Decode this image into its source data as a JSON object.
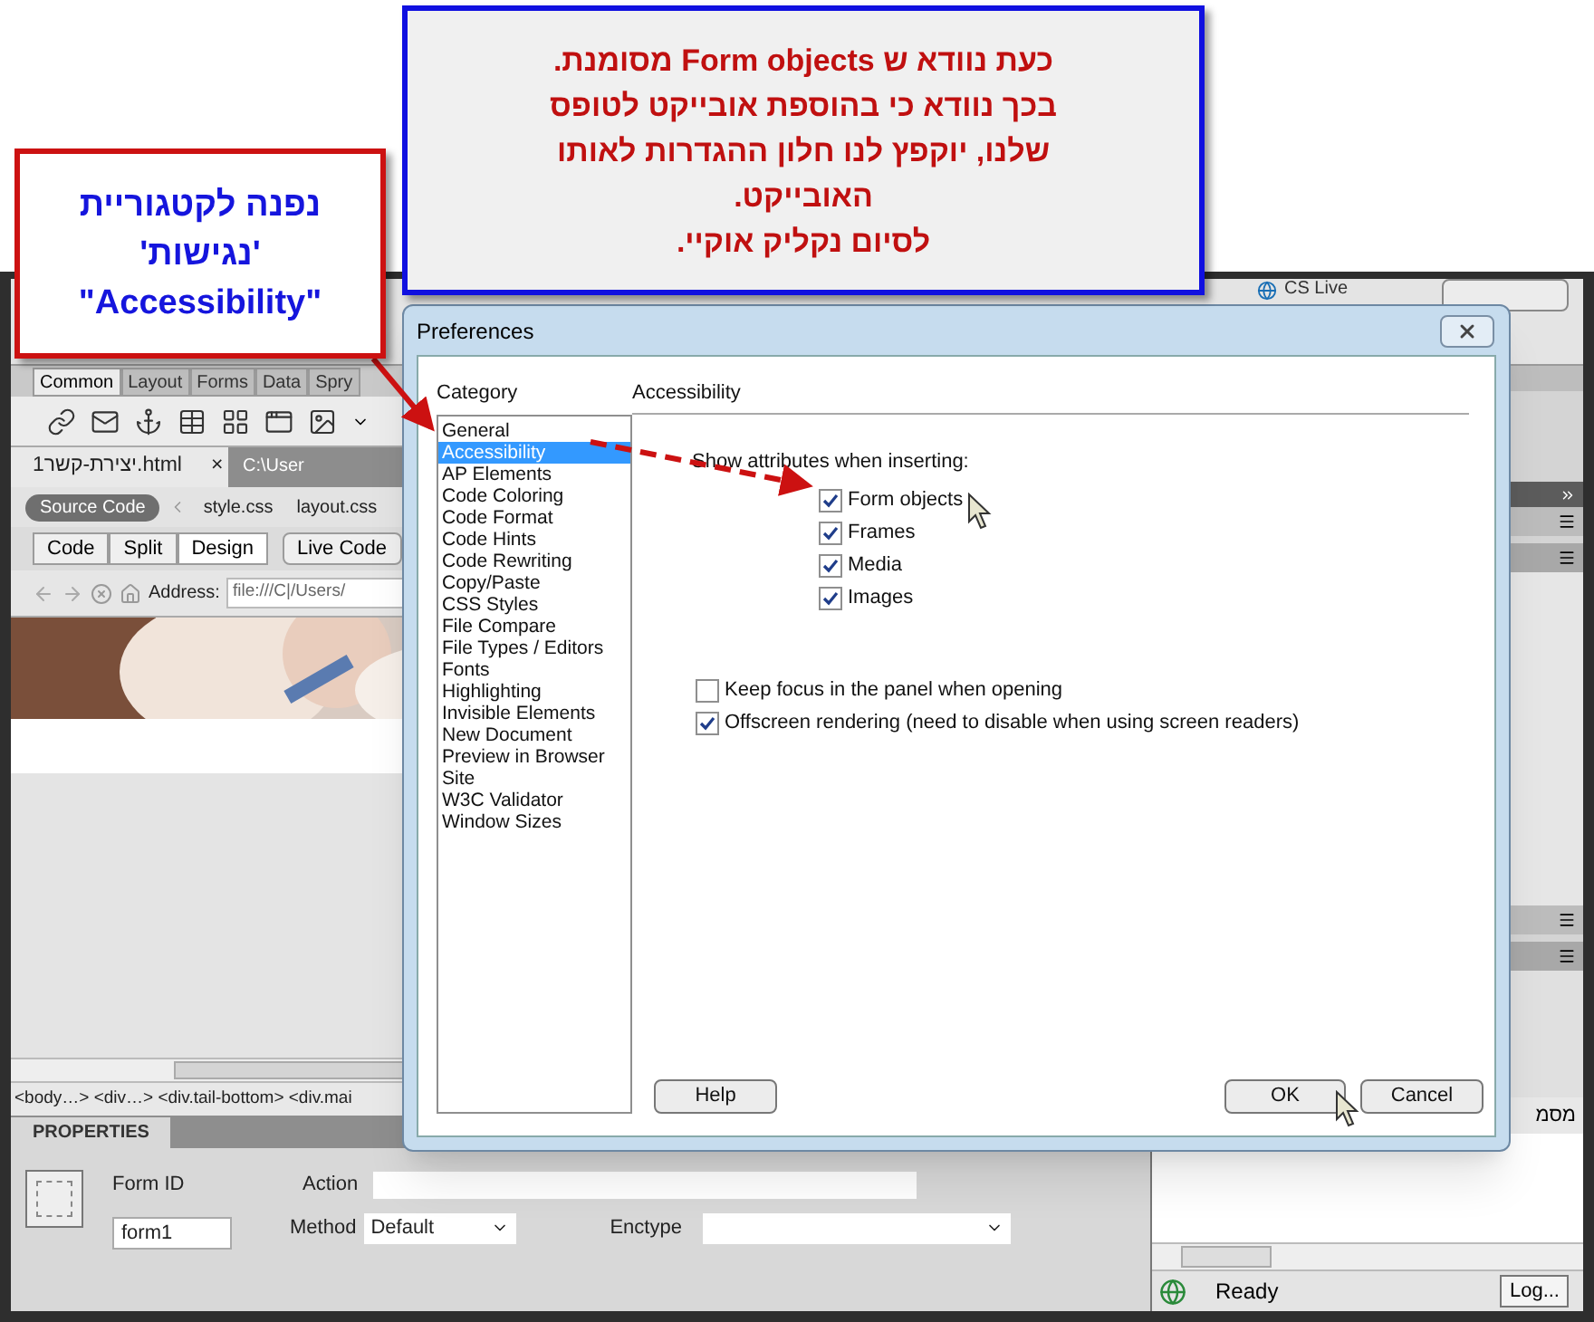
{
  "instruction_note": {
    "lines": [
      "כעת נוודא ש Form objects מסומנת.",
      "בכך נוודא כי בהוספת אובייקט לטופס",
      "שלנו, יוקפץ לנו חלון ההגדרות לאותו",
      "האובייקט.",
      "לסיום נקליק אוקיי."
    ]
  },
  "category_note": {
    "lines": [
      "נפנה לקטגוריית",
      "'נגישות'",
      "\"Accessibility\""
    ]
  },
  "app": {
    "title_bar": {
      "cs_live": "CS Live"
    },
    "insert_tabs": [
      {
        "label": "Common",
        "selected": true
      },
      {
        "label": "Layout",
        "selected": false
      },
      {
        "label": "Forms",
        "selected": false
      },
      {
        "label": "Data",
        "selected": false
      },
      {
        "label": "Spry",
        "selected": false
      }
    ],
    "document_tab": {
      "title": "יצירת-קשר1.html",
      "close": "×",
      "path": "C:\\User"
    },
    "related_files": [
      {
        "label": "Source Code",
        "selected": true
      },
      {
        "label": "style.css",
        "selected": false
      },
      {
        "label": "layout.css",
        "selected": false
      }
    ],
    "view_buttons": [
      {
        "label": "Code",
        "selected": false
      },
      {
        "label": "Split",
        "selected": false
      },
      {
        "label": "Design",
        "selected": true
      },
      {
        "label": "Live Code",
        "selected": false
      }
    ],
    "address": {
      "label": "Address:",
      "value": "file:///C|/Users/"
    },
    "tag_selector": "<body…> <div…> <div.tail-bottom> <div.mai",
    "properties": {
      "title": "PROPERTIES",
      "form_id_label": "Form ID",
      "form_id": "form1",
      "action_label": "Action",
      "method_label": "Method",
      "method": "Default",
      "enctype_label": "Enctype"
    },
    "side_panel": {
      "cut_text": "מסמ",
      "status": "Ready",
      "log_button": "Log..."
    }
  },
  "dialog": {
    "title": "Preferences",
    "category_label": "Category",
    "categories": [
      {
        "label": "General",
        "selected": false
      },
      {
        "label": "Accessibility",
        "selected": true
      },
      {
        "label": "AP Elements",
        "selected": false
      },
      {
        "label": "Code Coloring",
        "selected": false
      },
      {
        "label": "Code Format",
        "selected": false
      },
      {
        "label": "Code Hints",
        "selected": false
      },
      {
        "label": "Code Rewriting",
        "selected": false
      },
      {
        "label": "Copy/Paste",
        "selected": false
      },
      {
        "label": "CSS Styles",
        "selected": false
      },
      {
        "label": "File Compare",
        "selected": false
      },
      {
        "label": "File Types / Editors",
        "selected": false
      },
      {
        "label": "Fonts",
        "selected": false
      },
      {
        "label": "Highlighting",
        "selected": false
      },
      {
        "label": "Invisible Elements",
        "selected": false
      },
      {
        "label": "New Document",
        "selected": false
      },
      {
        "label": "Preview in Browser",
        "selected": false
      },
      {
        "label": "Site",
        "selected": false
      },
      {
        "label": "W3C Validator",
        "selected": false
      },
      {
        "label": "Window Sizes",
        "selected": false
      }
    ],
    "section_title": "Accessibility",
    "prompt": "Show attributes when inserting:",
    "attributes": [
      {
        "label": "Form objects",
        "checked": true
      },
      {
        "label": "Frames",
        "checked": true
      },
      {
        "label": "Media",
        "checked": true
      },
      {
        "label": "Images",
        "checked": true
      }
    ],
    "options": [
      {
        "label": "Keep focus in the panel when opening",
        "checked": false
      },
      {
        "label": "Offscreen rendering (need to disable when using screen readers)",
        "checked": true
      }
    ],
    "help": "Help",
    "ok": "OK",
    "cancel": "Cancel"
  }
}
